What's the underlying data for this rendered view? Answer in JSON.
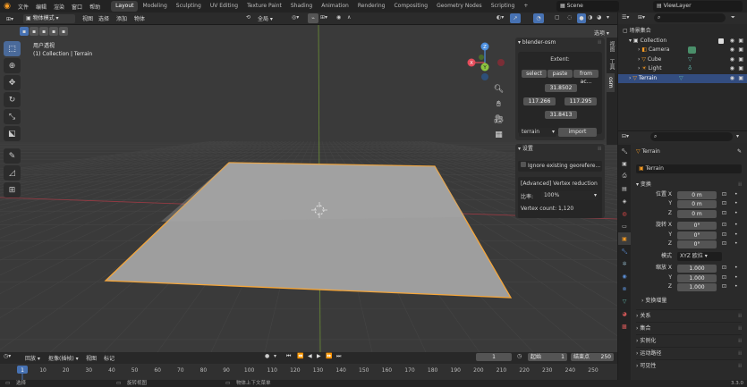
{
  "menubar": {
    "menus": [
      "文件",
      "编辑",
      "渲染",
      "窗口",
      "帮助"
    ],
    "workspaces": [
      "Layout",
      "Modeling",
      "Sculpting",
      "UV Editing",
      "Texture Paint",
      "Shading",
      "Animation",
      "Rendering",
      "Compositing",
      "Geometry Nodes",
      "Scripting"
    ],
    "active_workspace": "Layout",
    "scene": "Scene",
    "view_layer": "ViewLayer"
  },
  "viewport_header": {
    "mode": "物体模式",
    "menus": [
      "视图",
      "选择",
      "添加",
      "物体"
    ],
    "transform_orientation": "全局",
    "options": "选项"
  },
  "viewport": {
    "view_name": "用户透视",
    "collection_info": "(1) Collection | Terrain",
    "gizmo_axes": [
      "X",
      "Y",
      "Z"
    ]
  },
  "blender_osm": {
    "title": "blender-osm",
    "extent_label": "Extent:",
    "buttons": [
      "select",
      "paste",
      "from ac..."
    ],
    "max_lat": "31.8502",
    "min_lon": "117.266",
    "max_lon": "117.295",
    "min_lat": "31.8413",
    "source": "terrain",
    "import": "import"
  },
  "settings": {
    "title": "设置",
    "ignore_label": "Ignore existing georefere...",
    "advanced_label": "[Advanced] Vertex reduction",
    "ratio_label": "比率:",
    "ratio_value": "100%",
    "vertex_count": "Vertex count: 1,120"
  },
  "sidebar_tabs": [
    "视图",
    "工具",
    "osm"
  ],
  "outliner": {
    "scene_collection": "场景集合",
    "items": [
      {
        "name": "Collection",
        "level": 1
      },
      {
        "name": "Camera",
        "level": 2
      },
      {
        "name": "Cube",
        "level": 2
      },
      {
        "name": "Light",
        "level": 2
      },
      {
        "name": "Terrain",
        "level": 1,
        "selected": true
      }
    ]
  },
  "properties": {
    "object_name": "Terrain",
    "object_field": "Terrain",
    "transform_title": "变换",
    "location": {
      "label_x": "位置 X",
      "x": "0 m",
      "y": "0 m",
      "z": "0 m"
    },
    "rotation": {
      "label_x": "旋转 X",
      "x": "0°",
      "y": "0°",
      "z": "0°"
    },
    "mode_label": "模式",
    "mode_value": "XYZ 欧拉",
    "scale": {
      "label_x": "缩放 X",
      "x": "1.000",
      "y": "1.000",
      "z": "1.000"
    },
    "delta_transform": "变换增量",
    "sections": [
      "关系",
      "集合",
      "实例化",
      "运动路径",
      "可见性"
    ],
    "axis_labels": [
      "Y",
      "Z"
    ]
  },
  "timeline": {
    "menus": [
      "回放",
      "抠像(插帧)",
      "视图",
      "标记"
    ],
    "current_frame": "1",
    "start_label": "起始",
    "start": "1",
    "end_label": "结束点",
    "end": "250",
    "ticks": [
      "1",
      "10",
      "20",
      "30",
      "40",
      "50",
      "60",
      "70",
      "80",
      "90",
      "100",
      "110",
      "120",
      "130",
      "140",
      "150",
      "160",
      "170",
      "180",
      "190",
      "200",
      "210",
      "220",
      "230",
      "240",
      "250"
    ]
  },
  "statusbar": {
    "select": "选择",
    "rotate": "旋转视图",
    "context": "物体上下文菜单",
    "version": "3.3.0"
  },
  "colors": {
    "accent_blue": "#4772b3",
    "selection_orange": "#f5a63a",
    "axis_x": "#e44b5a",
    "axis_y": "#8cc43f",
    "axis_z": "#4c8fdf"
  }
}
